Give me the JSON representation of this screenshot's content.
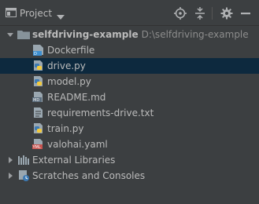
{
  "header": {
    "title": "Project",
    "icons": [
      "project-view-icon",
      "chevron-down-icon",
      "locate-icon",
      "collapse-all-icon",
      "gear-icon",
      "minimize-icon"
    ]
  },
  "tree": {
    "root": {
      "name": "selfdriving-example",
      "path": "D:\\selfdriving-example",
      "expanded": true
    },
    "files": [
      {
        "name": "Dockerfile",
        "icon": "docker-file-icon"
      },
      {
        "name": "drive.py",
        "icon": "python-file-icon",
        "selected": true
      },
      {
        "name": "model.py",
        "icon": "python-file-icon"
      },
      {
        "name": "README.md",
        "icon": "markdown-file-icon"
      },
      {
        "name": "requirements-drive.txt",
        "icon": "text-file-icon"
      },
      {
        "name": "train.py",
        "icon": "python-file-icon"
      },
      {
        "name": "valohai.yaml",
        "icon": "yaml-file-icon"
      }
    ],
    "external_libraries": "External Libraries",
    "scratches": "Scratches and Consoles"
  },
  "colors": {
    "background": "#3c3f41",
    "selection": "#0d293e",
    "text": "#bbbbbb",
    "path_text": "#8c8c8c",
    "folder": "#87939a",
    "python_blue": "#3d7ab3",
    "python_yellow": "#f2c93b"
  }
}
